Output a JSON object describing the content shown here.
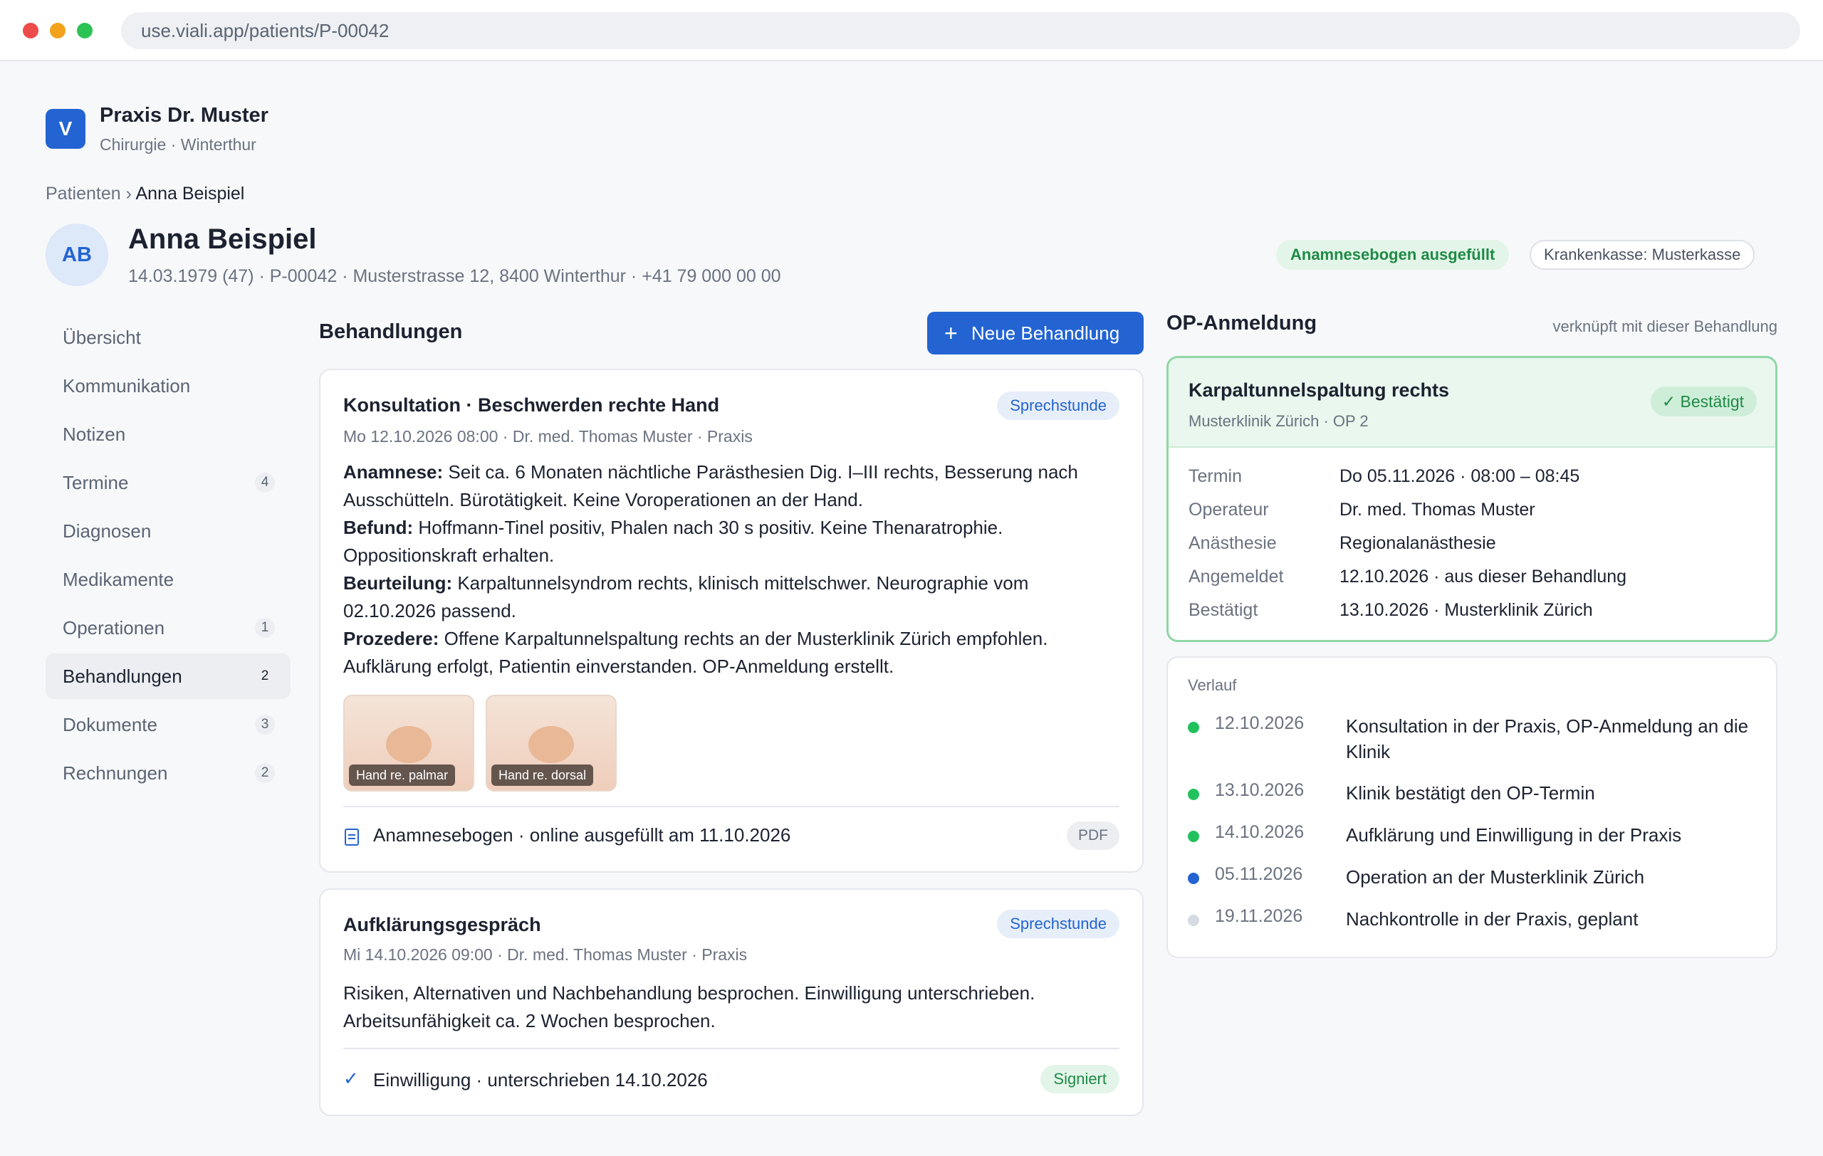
{
  "browser": {
    "url": "use.viali.app/patients/P-00042"
  },
  "practice": {
    "logo_letter": "V",
    "name": "Praxis Dr. Muster",
    "subtitle": "Chirurgie · Winterthur"
  },
  "breadcrumb": {
    "parent": "Patienten",
    "separator": " › ",
    "current": "Anna Beispiel"
  },
  "patient": {
    "initials": "AB",
    "name": "Anna Beispiel",
    "meta": "14.03.1979 (47) · P-00042 · Musterstrasse 12, 8400 Winterthur · +41 79 000 00 00",
    "badges": {
      "questionnaire": "Anamnesebogen ausgefüllt",
      "insurance": "Krankenkasse: Musterkasse"
    }
  },
  "sidebar": {
    "items": [
      {
        "label": "Übersicht",
        "count": ""
      },
      {
        "label": "Kommunikation",
        "count": ""
      },
      {
        "label": "Notizen",
        "count": ""
      },
      {
        "label": "Termine",
        "count": "4"
      },
      {
        "label": "Diagnosen",
        "count": ""
      },
      {
        "label": "Medikamente",
        "count": ""
      },
      {
        "label": "Operationen",
        "count": "1"
      },
      {
        "label": "Behandlungen",
        "count": "2",
        "active": true
      },
      {
        "label": "Dokumente",
        "count": "3"
      },
      {
        "label": "Rechnungen",
        "count": "2"
      }
    ]
  },
  "treatments": {
    "title": "Behandlungen",
    "new_button": "Neue Behandlung",
    "items": [
      {
        "title": "Konsultation · Beschwerden rechte Hand",
        "tag": "Sprechstunde",
        "meta": "Mo 12.10.2026 08:00 · Dr. med. Thomas Muster · Praxis",
        "sections": [
          {
            "label": "Anamnese:",
            "text": " Seit ca. 6 Monaten nächtliche Parästhesien Dig. I–III rechts, Besserung nach Ausschütteln. Bürotätigkeit. Keine Voroperationen an der Hand."
          },
          {
            "label": "Befund:",
            "text": " Hoffmann-Tinel positiv, Phalen nach 30 s positiv. Keine Thenaratrophie. Oppositionskraft erhalten."
          },
          {
            "label": "Beurteilung:",
            "text": " Karpaltunnelsyndrom rechts, klinisch mittelschwer. Neurographie vom 02.10.2026 passend."
          },
          {
            "label": "Prozedere:",
            "text": " Offene Karpaltunnelspaltung rechts an der Musterklinik Zürich empfohlen. Aufklärung erfolgt, Patientin einverstanden. OP-Anmeldung erstellt."
          }
        ],
        "images": [
          "Hand re. palmar",
          "Hand re. dorsal"
        ],
        "document": {
          "text": "Anamnesebogen · online ausgefüllt am 11.10.2026",
          "type": "PDF",
          "icon": "document-icon"
        }
      },
      {
        "title": "Aufklärungsgespräch",
        "tag": "Sprechstunde",
        "meta": "Mi 14.10.2026 09:00 · Dr. med. Thomas Muster · Praxis",
        "text": "Risiken, Alternativen und Nachbehandlung besprochen. Einwilligung unterschrieben. Arbeitsunfähigkeit ca. 2 Wochen besprochen.",
        "consent": {
          "text": "Einwilligung · unterschrieben 14.10.2026",
          "status": "Signiert",
          "icon": "check-icon"
        }
      }
    ]
  },
  "op": {
    "title": "OP-Anmeldung",
    "linked": "verknüpft mit dieser Behandlung",
    "procedure": "Karpaltunnelspaltung rechts",
    "location": "Musterklinik Zürich · OP 2",
    "status": "Bestätigt",
    "details": [
      {
        "key": "Termin",
        "value": "Do 05.11.2026 · 08:00 – 08:45"
      },
      {
        "key": "Operateur",
        "value": "Dr. med. Thomas Muster"
      },
      {
        "key": "Anästhesie",
        "value": "Regionalanästhesie"
      },
      {
        "key": "Angemeldet",
        "value": "12.10.2026 · aus dieser Behandlung"
      },
      {
        "key": "Bestätigt",
        "value": "13.10.2026 · Musterklinik Zürich"
      }
    ]
  },
  "timeline": {
    "title": "Verlauf",
    "items": [
      {
        "date": "12.10.2026",
        "text": "Konsultation in der Praxis, OP-Anmeldung an die Klinik",
        "state": "done"
      },
      {
        "date": "13.10.2026",
        "text": "Klinik bestätigt den OP-Termin",
        "state": "done"
      },
      {
        "date": "14.10.2026",
        "text": "Aufklärung und Einwilligung in der Praxis",
        "state": "done"
      },
      {
        "date": "05.11.2026",
        "text": "Operation an der Musterklinik Zürich",
        "state": "upcoming"
      },
      {
        "date": "19.11.2026",
        "text": "Nachkontrolle in der Praxis, geplant",
        "state": "planned"
      }
    ]
  },
  "colors": {
    "accent": "#2364d2",
    "success": "#1f8a46",
    "success_bg": "#e3f5e8",
    "done_dot": "#22c15e",
    "upcoming_dot": "#2364d2",
    "planned_dot": "#d6dae1"
  }
}
